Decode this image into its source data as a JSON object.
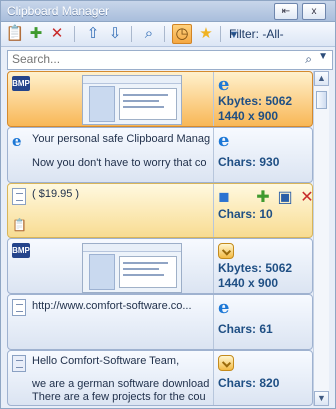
{
  "window": {
    "title": "Clipboard Manager",
    "title_buttons": [
      "⇤",
      "x"
    ]
  },
  "toolbar": {
    "filter_label": "Filter: -All-",
    "icons": [
      {
        "name": "paste-icon",
        "glyph": "📋"
      },
      {
        "name": "add-icon",
        "glyph": "✚"
      },
      {
        "name": "delete-icon",
        "glyph": "✕"
      },
      {
        "name": "move-up-icon",
        "glyph": "⇧"
      },
      {
        "name": "move-down-icon",
        "glyph": "⇩"
      },
      {
        "name": "search-window-icon",
        "glyph": "⌕"
      },
      {
        "name": "timer-icon",
        "glyph": "◷"
      },
      {
        "name": "favorite-icon",
        "glyph": "★"
      },
      {
        "name": "filter-icon",
        "glyph": "▼"
      }
    ]
  },
  "search": {
    "placeholder": "Search...",
    "icon": "⌕",
    "dropdown": "▼"
  },
  "items": [
    {
      "kind": "image",
      "badge": "BMP",
      "meta1": "Kbytes: 5062",
      "meta2": "1440 x 900",
      "source_icon": "e"
    },
    {
      "kind": "text",
      "line1": "Your personal safe Clipboard Manage",
      "line2": "Now you don't have to worry that co",
      "meta1": "Chars: 930",
      "source_icon": "e"
    },
    {
      "kind": "text",
      "line1": "( $19.95 )",
      "meta1": "Chars: 10",
      "source_icon": "◼"
    },
    {
      "kind": "image",
      "badge": "BMP",
      "meta1": "Kbytes: 5062",
      "meta2": "1440 x 900",
      "source_icon": "✓"
    },
    {
      "kind": "text",
      "line1": "http://www.comfort-software.co...",
      "meta1": "Chars: 61",
      "source_icon": "e"
    },
    {
      "kind": "text",
      "line1": "Hello Comfort-Software Team,",
      "line2": "we are a german software download",
      "line3": "There are a few projects for the cou",
      "meta1": "Chars: 820",
      "source_icon": "✓"
    }
  ],
  "scrollbar": {
    "up": "▲",
    "down": "▼"
  }
}
